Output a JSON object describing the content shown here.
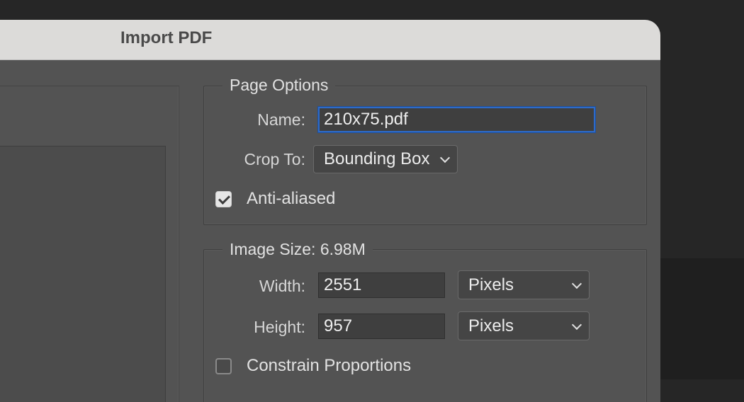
{
  "dialog": {
    "title": "Import PDF"
  },
  "page_options": {
    "group_label": "Page Options",
    "name_label": "Name:",
    "name_value": "210x75.pdf",
    "crop_label": "Crop To:",
    "crop_value": "Bounding Box",
    "antialiased_label": "Anti-aliased",
    "antialiased_checked": true
  },
  "image_size": {
    "group_label": "Image Size: 6.98M",
    "width_label": "Width:",
    "width_value": "2551",
    "width_unit": "Pixels",
    "height_label": "Height:",
    "height_value": "957",
    "height_unit": "Pixels",
    "constrain_label": "Constrain Proportions",
    "constrain_checked": false
  },
  "colors": {
    "accent_focus": "#2d6ac9",
    "dialog_bg": "#535353",
    "titlebar_bg": "#dcdbd9"
  }
}
